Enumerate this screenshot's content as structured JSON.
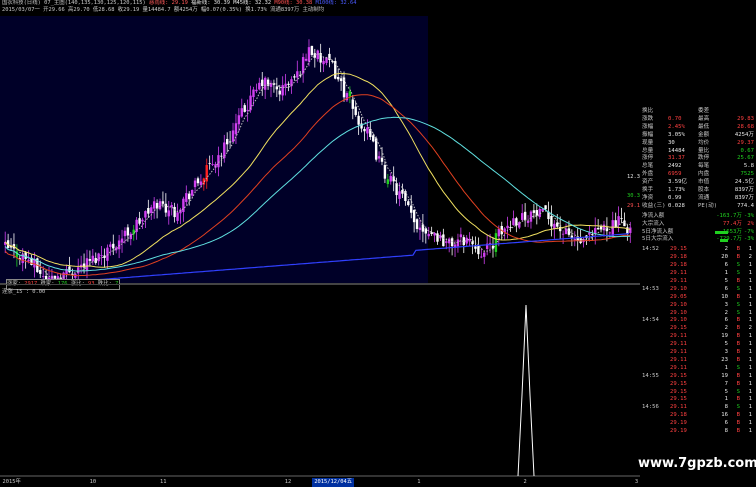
{
  "topbar": {
    "line1": [
      {
        "text": "国农科技(日线) 07_主图(140,135,130,125,120,115)",
        "color": "#c8c8c8"
      },
      {
        "text": "慈雨线: 29.19",
        "color": "#ff5a5a"
      },
      {
        "text": "福新线: 30.39",
        "color": "#e0e0e0"
      },
      {
        "text": "M45线: 32.32",
        "color": "#e8e8e8"
      },
      {
        "text": "M90线: 30.38",
        "color": "#ff5050"
      },
      {
        "text": "M100线: 32.64",
        "color": "#4a5aff"
      }
    ],
    "line2": "2015/03/07一 开29.66 高29.70 低28.68 收29.19 量14484.7 额4254万 幅0.07(0.35%) 换1.73% 流通8397万 主动制均"
  },
  "kline": {
    "price_labels": [
      {
        "text": "12.32",
        "color": "#e8e8e8"
      },
      {
        "text": "30.38",
        "color": "#20d020"
      },
      {
        "text": "29.19",
        "color": "#ff5050"
      }
    ]
  },
  "stats_box": {
    "items": [
      {
        "label": "涨家:",
        "value": "2917",
        "color": "#ff4040"
      },
      {
        "label": "跌家:",
        "value": "176",
        "color": "#20d020"
      },
      {
        "label": "涨比:",
        "value": "93",
        "color": "#ff4040"
      },
      {
        "label": "跌比:",
        "value": "7",
        "color": "#20d020"
      }
    ]
  },
  "indicator": {
    "title": "连涨_15 : 0.00",
    "value_label": "0.75"
  },
  "xaxis": {
    "ticks": [
      {
        "text": "2015年",
        "pos": 0.004
      },
      {
        "text": "10",
        "pos": 0.14
      },
      {
        "text": "11",
        "pos": 0.25
      },
      {
        "text": "12",
        "pos": 0.445
      },
      {
        "text": "2015/12/04五",
        "pos": 0.488,
        "highlight": true
      },
      {
        "text": "1",
        "pos": 0.652
      },
      {
        "text": "2",
        "pos": 0.818
      },
      {
        "text": "3",
        "pos": 0.992
      }
    ]
  },
  "quote": {
    "rows": [
      {
        "l": "换比",
        "v": "",
        "l2": "委差",
        "v2": ""
      },
      {
        "l": "涨跌",
        "v": "0.70",
        "vc": "#ff4040",
        "l2": "最高",
        "v2": "29.83",
        "v2c": "#ff4040"
      },
      {
        "l": "涨幅",
        "v": "2.45%",
        "vc": "#ff4040",
        "l2": "最低",
        "v2": "28.68",
        "v2c": "#ff4040"
      },
      {
        "l": "振幅",
        "v": "3.05%",
        "vc": "#e8e8e8",
        "l2": "金额",
        "v2": "4254万",
        "v2c": "#e8e8e8"
      },
      {
        "l": "现量",
        "v": "30",
        "vc": "#e8e8e8",
        "l2": "均价",
        "v2": "29.37",
        "v2c": "#ff4040"
      },
      {
        "l": "总量",
        "v": "14484",
        "vc": "#e8e8e8",
        "l2": "量比",
        "v2": "0.67",
        "v2c": "#20d020"
      },
      {
        "l": "涨停",
        "v": "31.37",
        "vc": "#ff4040",
        "l2": "跌停",
        "v2": "25.67",
        "v2c": "#20d020"
      },
      {
        "l": "总笔",
        "v": "2492",
        "vc": "#e8e8e8",
        "l2": "每笔",
        "v2": "5.8",
        "v2c": "#e8e8e8"
      },
      {
        "l": "外盘",
        "v": "6959",
        "vc": "#ff4040",
        "l2": "内盘",
        "v2": "7525",
        "v2c": "#20d020"
      },
      {
        "l": "资产",
        "v": "3.59亿",
        "vc": "#e8e8e8",
        "l2": "市值",
        "v2": "24.5亿",
        "v2c": "#e8e8e8"
      },
      {
        "l": "换手",
        "v": "1.73%",
        "vc": "#e8e8e8",
        "l2": "股本",
        "v2": "8397万",
        "v2c": "#e8e8e8"
      },
      {
        "l": "净资",
        "v": "0.99",
        "vc": "#e8e8e8",
        "l2": "流通",
        "v2": "8397万",
        "v2c": "#e8e8e8"
      },
      {
        "l": "收益(三)",
        "v": "0.028",
        "vc": "#e8e8e8",
        "l2": "PE(动)",
        "v2": "774.4",
        "v2c": "#e8e8e8"
      }
    ],
    "flows": [
      {
        "label": "净流入额",
        "value": "-163.7万",
        "pct": "-3%",
        "color": "#20d020",
        "bar": 0.0
      },
      {
        "label": "大宗流入",
        "value": "77.4万",
        "pct": "2%",
        "color": "#ff4040",
        "bar": 0.0
      },
      {
        "label": "5日净流入额",
        "value": "-1653万",
        "pct": "-7%",
        "color": "#20d020",
        "bar": 0.55
      },
      {
        "label": "5日大宗流入",
        "value": "-729.7万",
        "pct": "-3%",
        "color": "#20d020",
        "bar": 0.35
      }
    ],
    "ticks": [
      {
        "t": "14:52",
        "p": "29.15",
        "v": "2",
        "s": "B",
        "n": "1"
      },
      {
        "t": "",
        "p": "29.18",
        "v": "20",
        "s": "B",
        "n": "2"
      },
      {
        "t": "",
        "p": "29.18",
        "v": "6",
        "s": "S",
        "n": "1"
      },
      {
        "t": "",
        "p": "29.11",
        "v": "1",
        "s": "S",
        "n": "1"
      },
      {
        "t": "",
        "p": "29.11",
        "v": "5",
        "s": "B",
        "n": "1"
      },
      {
        "t": "14:53",
        "p": "29.10",
        "v": "6",
        "s": "S",
        "n": "1"
      },
      {
        "t": "",
        "p": "29.05",
        "v": "10",
        "s": "B",
        "n": "1"
      },
      {
        "t": "",
        "p": "29.10",
        "v": "3",
        "s": "S",
        "n": "1"
      },
      {
        "t": "",
        "p": "29.10",
        "v": "2",
        "s": "S",
        "n": "1"
      },
      {
        "t": "14:54",
        "p": "29.10",
        "v": "6",
        "s": "B",
        "n": "1"
      },
      {
        "t": "",
        "p": "29.15",
        "v": "2",
        "s": "B",
        "n": "2"
      },
      {
        "t": "",
        "p": "29.11",
        "v": "19",
        "s": "B",
        "n": "1"
      },
      {
        "t": "",
        "p": "29.11",
        "v": "5",
        "s": "B",
        "n": "1"
      },
      {
        "t": "",
        "p": "29.11",
        "v": "3",
        "s": "B",
        "n": "1"
      },
      {
        "t": "",
        "p": "29.11",
        "v": "23",
        "s": "B",
        "n": "1"
      },
      {
        "t": "",
        "p": "29.11",
        "v": "1",
        "s": "S",
        "n": "1"
      },
      {
        "t": "14:55",
        "p": "29.15",
        "v": "19",
        "s": "B",
        "n": "1"
      },
      {
        "t": "",
        "p": "29.15",
        "v": "7",
        "s": "B",
        "n": "1"
      },
      {
        "t": "",
        "p": "29.15",
        "v": "5",
        "s": "S",
        "n": "1"
      },
      {
        "t": "",
        "p": "29.15",
        "v": "1",
        "s": "B",
        "n": "1"
      },
      {
        "t": "14:56",
        "p": "29.11",
        "v": "8",
        "s": "S",
        "n": "1"
      },
      {
        "t": "",
        "p": "29.18",
        "v": "16",
        "s": "B",
        "n": "1"
      },
      {
        "t": "",
        "p": "29.19",
        "v": "6",
        "s": "B",
        "n": "1"
      },
      {
        "t": "",
        "p": "29.19",
        "v": "8",
        "s": "B",
        "n": "1"
      }
    ]
  },
  "watermark": "www.7gpzb.com",
  "colors": {
    "up": "#d040f0",
    "down": "#ffffff",
    "limit_up": "#ff2020",
    "limit_down": "#20d020",
    "ma_yellow": "#f0e060",
    "ma_red": "#e04020",
    "ma_cyan": "#60e0e0",
    "ma_blue": "#3040ff",
    "ma_dash": "#c0c0c0",
    "panel_bg": "#000028"
  }
}
